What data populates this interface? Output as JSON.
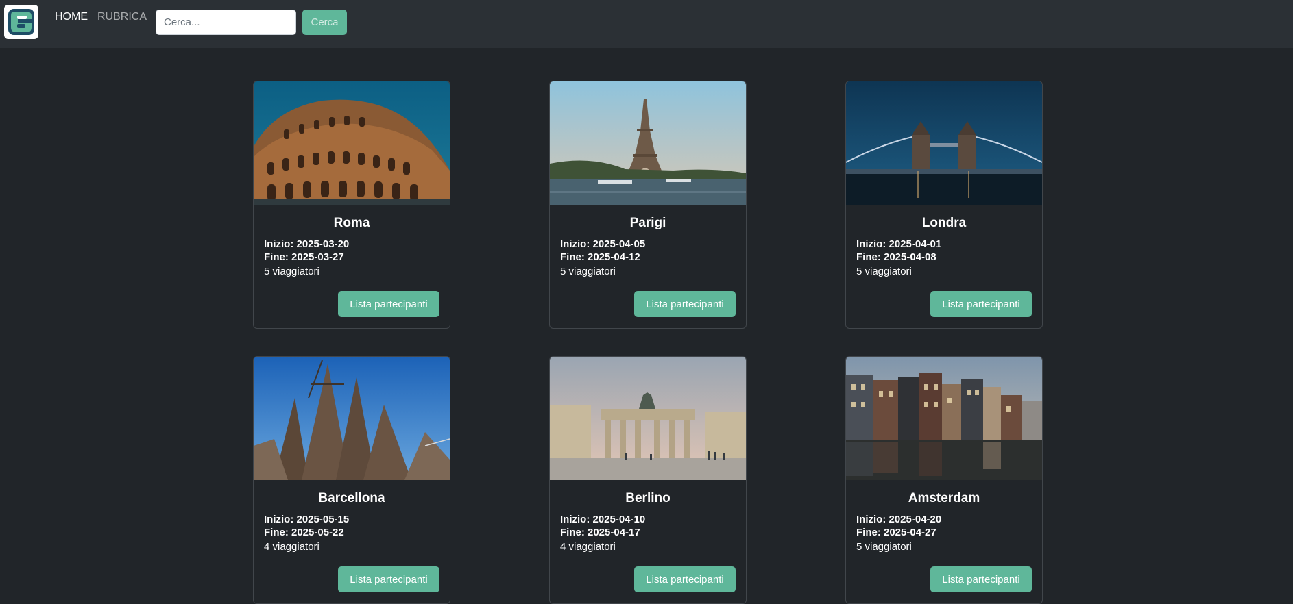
{
  "navbar": {
    "logo_icon": "app-logo-icon",
    "links": [
      {
        "label": "HOME",
        "active": true
      },
      {
        "label": "RUBRICA",
        "active": false
      }
    ],
    "search": {
      "placeholder": "Cerca...",
      "value": ""
    },
    "search_button_label": "Cerca"
  },
  "colors": {
    "background": "#212529",
    "navbar": "#2b3035",
    "accent": "#5fb79a"
  },
  "trips": [
    {
      "city": "Roma",
      "start": "Inizio: 2025-03-20",
      "end": "Fine: 2025-03-27",
      "travelers": "5 viaggiatori",
      "button": "Lista partecipanti",
      "image_icon": "colosseum-photo"
    },
    {
      "city": "Parigi",
      "start": "Inizio: 2025-04-05",
      "end": "Fine: 2025-04-12",
      "travelers": "5 viaggiatori",
      "button": "Lista partecipanti",
      "image_icon": "eiffel-tower-photo"
    },
    {
      "city": "Londra",
      "start": "Inizio: 2025-04-01",
      "end": "Fine: 2025-04-08",
      "travelers": "5 viaggiatori",
      "button": "Lista partecipanti",
      "image_icon": "tower-bridge-photo"
    },
    {
      "city": "Barcellona",
      "start": "Inizio: 2025-05-15",
      "end": "Fine: 2025-05-22",
      "travelers": "4 viaggiatori",
      "button": "Lista partecipanti",
      "image_icon": "sagrada-familia-photo"
    },
    {
      "city": "Berlino",
      "start": "Inizio: 2025-04-10",
      "end": "Fine: 2025-04-17",
      "travelers": "4 viaggiatori",
      "button": "Lista partecipanti",
      "image_icon": "brandenburg-gate-photo"
    },
    {
      "city": "Amsterdam",
      "start": "Inizio: 2025-04-20",
      "end": "Fine: 2025-04-27",
      "travelers": "5 viaggiatori",
      "button": "Lista partecipanti",
      "image_icon": "amsterdam-canal-houses-photo"
    }
  ]
}
